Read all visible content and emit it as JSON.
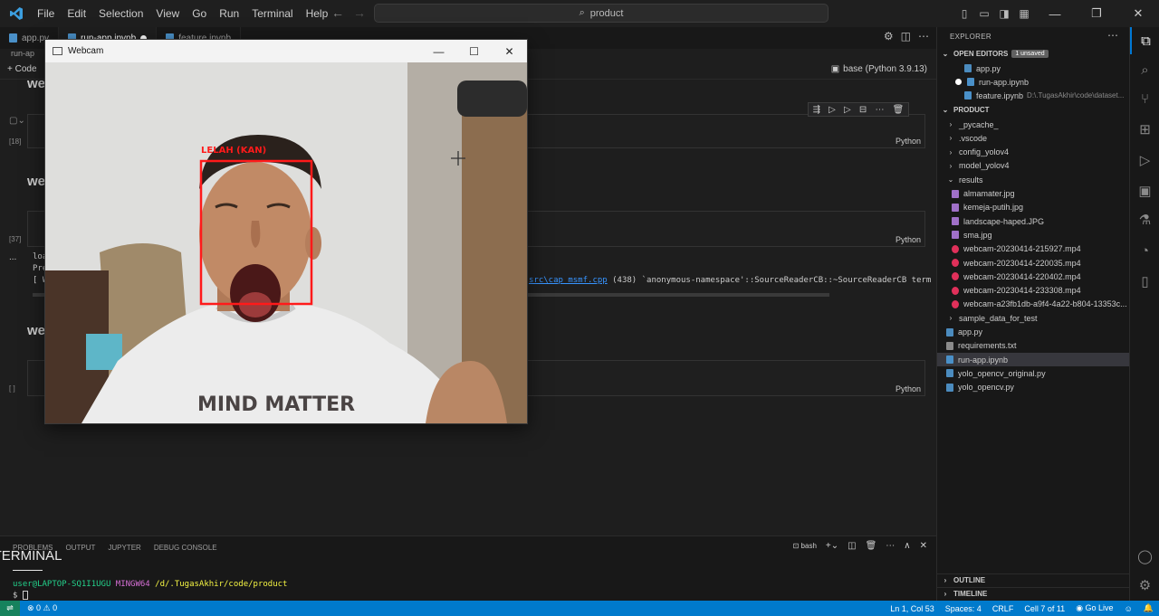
{
  "menu": [
    "File",
    "Edit",
    "Selection",
    "View",
    "Go",
    "Run",
    "Terminal",
    "Help"
  ],
  "command_center": {
    "text": "product"
  },
  "tabs": [
    {
      "label": "app.py",
      "active": false,
      "modified": false
    },
    {
      "label": "run-app.ipynb",
      "active": true,
      "modified": true
    },
    {
      "label": "feature.ipynb",
      "active": false,
      "modified": false
    }
  ],
  "breadcrumb": "run-ap",
  "notebook": {
    "add_code": "Code",
    "kernel": "base (Python 3.9.13)",
    "md_headings": [
      "we",
      "we",
      "we"
    ],
    "cells": [
      {
        "exec": "[18]",
        "lang": "Python"
      },
      {
        "exec": "[37]",
        "lang": "Python"
      },
      {
        "exec": "[ ]",
        "lang": "Python"
      }
    ],
    "output_lines": [
      "loa",
      "Pre",
      "[ W"
    ],
    "output_link": "src\\cap_msmf.cpp",
    "output_tail": "(438) `anonymous-namespace'::SourceReaderCB::~SourceReaderCB term",
    "ellipsis": "..."
  },
  "webcam": {
    "title": "Webcam",
    "detection_label": "LELAH (KAN)",
    "shirt_text": "MIND MATTER",
    "detection_color": "#ff1a1a"
  },
  "panel": {
    "tabs": [
      "PROBLEMS",
      "OUTPUT",
      "JUPYTER",
      "TERMINAL",
      "DEBUG CONSOLE"
    ],
    "active_tab": "TERMINAL",
    "shell": "bash",
    "prompt_user": "user@LAPTOP-SQ1I1UGU",
    "prompt_env": "MINGW64",
    "prompt_path": "/d/.TugasAkhir/code/product",
    "prompt_symbol": "$"
  },
  "explorer": {
    "title": "EXPLORER",
    "open_editors": "OPEN EDITORS",
    "unsaved_badge": "1 unsaved",
    "open_files": [
      {
        "name": "app.py",
        "type": "py"
      },
      {
        "name": "run-app.ipynb",
        "type": "nb"
      },
      {
        "name": "feature.ipynb",
        "type": "nb",
        "path": "D:\\.TugasAkhir\\code\\dataset..."
      }
    ],
    "folder": "PRODUCT",
    "tree": [
      {
        "name": "_pycache_",
        "kind": "folder",
        "depth": 1
      },
      {
        "name": ".vscode",
        "kind": "folder",
        "depth": 1
      },
      {
        "name": "config_yolov4",
        "kind": "folder",
        "depth": 1
      },
      {
        "name": "model_yolov4",
        "kind": "folder",
        "depth": 1
      },
      {
        "name": "results",
        "kind": "folder-open",
        "depth": 1
      },
      {
        "name": "almamater.jpg",
        "kind": "img",
        "depth": 2
      },
      {
        "name": "kemeja-putih.jpg",
        "kind": "img",
        "depth": 2
      },
      {
        "name": "landscape-haped.JPG",
        "kind": "img",
        "depth": 2
      },
      {
        "name": "sma.jpg",
        "kind": "img",
        "depth": 2
      },
      {
        "name": "webcam-20230414-215927.mp4",
        "kind": "vid",
        "depth": 2
      },
      {
        "name": "webcam-20230414-220035.mp4",
        "kind": "vid",
        "depth": 2
      },
      {
        "name": "webcam-20230414-220402.mp4",
        "kind": "vid",
        "depth": 2
      },
      {
        "name": "webcam-20230414-233308.mp4",
        "kind": "vid",
        "depth": 2
      },
      {
        "name": "webcam-a23fb1db-a9f4-4a22-b804-13353c...",
        "kind": "vid",
        "depth": 2
      },
      {
        "name": "sample_data_for_test",
        "kind": "folder",
        "depth": 1
      },
      {
        "name": "app.py",
        "kind": "py",
        "depth": 1
      },
      {
        "name": "requirements.txt",
        "kind": "txt",
        "depth": 1
      },
      {
        "name": "run-app.ipynb",
        "kind": "nb",
        "depth": 1,
        "selected": true
      },
      {
        "name": "yolo_opencv_original.py",
        "kind": "py",
        "depth": 1
      },
      {
        "name": "yolo_opencv.py",
        "kind": "py",
        "depth": 1
      }
    ],
    "outline": "OUTLINE",
    "timeline": "TIMELINE"
  },
  "statusbar": {
    "problems": "⊗ 0 ⚠ 0",
    "position": "Ln 1, Col 53",
    "spaces": "Spaces: 4",
    "eol": "CRLF",
    "cell": "Cell 7 of 11",
    "golive": "Go Live"
  }
}
